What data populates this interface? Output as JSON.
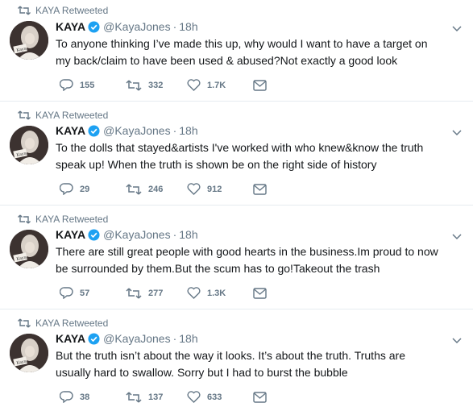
{
  "tweets": [
    {
      "retweeted_by": "KAYA Retweeted",
      "name": "KAYA",
      "handle": "@KayaJones",
      "separator": "·",
      "time": "18h",
      "text_line1": "To anyone thinking I’ve made this up, why would I want to have a target on",
      "text_line2": "my back/claim to have been used & abused?Not exactly a good look",
      "replies": "155",
      "retweets": "332",
      "likes": "1.7K"
    },
    {
      "retweeted_by": "KAYA Retweeted",
      "name": "KAYA",
      "handle": "@KayaJones",
      "separator": "·",
      "time": "18h",
      "text_line1": "To the dolls that stayed&artists I've worked with who knew&know the truth",
      "text_line2": "speak up! When the truth is shown be on the right side of history",
      "replies": "29",
      "retweets": "246",
      "likes": "912"
    },
    {
      "retweeted_by": "KAYA Retweeted",
      "name": "KAYA",
      "handle": "@KayaJones",
      "separator": "·",
      "time": "18h",
      "text_line1": "There are still great people with good hearts in the business.Im proud to now",
      "text_line2": "be surrounded by them.But the scum has to go!Takeout the trash",
      "replies": "57",
      "retweets": "277",
      "likes": "1.3K"
    },
    {
      "retweeted_by": "KAYA Retweeted",
      "name": "KAYA",
      "handle": "@KayaJones",
      "separator": "·",
      "time": "18h",
      "text_line1": "But the truth isn’t about the way it looks. It’s about the truth. Truths are",
      "text_line2": "usually hard to swallow. Sorry but I had to burst the bubble",
      "replies": "38",
      "retweets": "137",
      "likes": "633"
    }
  ],
  "avatar_caption": "Kaya",
  "colors": {
    "verified": "#1da1f2",
    "meta": "#657786",
    "text": "#14171a",
    "divider": "#e6ecf0"
  },
  "icons": [
    "retweet-icon",
    "verified-badge-icon",
    "chevron-down-icon",
    "reply-icon",
    "like-icon",
    "direct-message-icon"
  ]
}
